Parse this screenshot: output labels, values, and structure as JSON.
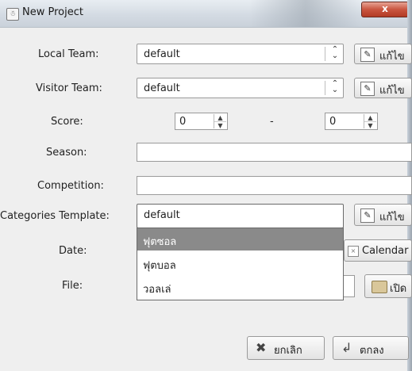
{
  "window": {
    "title": "New Project",
    "close_label": "x"
  },
  "form": {
    "local_team": {
      "label": "Local Team:",
      "value": "default",
      "edit_label": "แก้ไข"
    },
    "visitor_team": {
      "label": "Visitor Team:",
      "value": "default",
      "edit_label": "แก้ไข"
    },
    "score": {
      "label": "Score:",
      "local_value": "0",
      "separator": "-",
      "visitor_value": "0"
    },
    "season": {
      "label": "Season:",
      "value": ""
    },
    "competition": {
      "label": "Competition:",
      "value": ""
    },
    "categories_template": {
      "label": "Categories Template:",
      "value": "default",
      "edit_label": "แก้ไข",
      "options": [
        "ฟุตซอล",
        "ฟุตบอล",
        "วอลเล่"
      ],
      "highlighted_index": 0
    },
    "date": {
      "label": "Date:",
      "calendar_label": "Calendar"
    },
    "file": {
      "label": "File:",
      "value": "",
      "open_label": "เปิด"
    }
  },
  "actions": {
    "cancel_label": "ยกเลิก",
    "ok_label": "ตกลง"
  },
  "icons": {
    "app": "window-icon",
    "edit": "pencil-edit-icon",
    "calendar": "calendar-icon",
    "open": "folder-icon",
    "cancel": "cancel-icon",
    "ok": "ok-return-icon"
  },
  "colors": {
    "highlight": "#8a8a8a",
    "close_button": "#c9553f"
  }
}
